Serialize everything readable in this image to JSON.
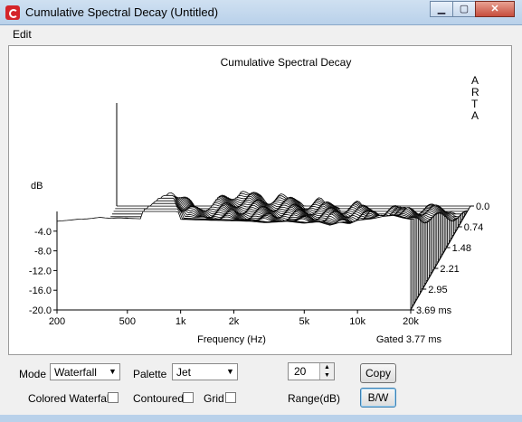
{
  "window": {
    "title": "Cumulative Spectral Decay  (Untitled)",
    "minimize_icon": "minimize-icon",
    "maximize_icon": "maximize-icon",
    "close_icon": "close-icon"
  },
  "menu": {
    "edit": "Edit"
  },
  "chart_data": {
    "type": "waterfall",
    "title": "Cumulative Spectral Decay",
    "watermark": "ARTA",
    "y_axis_title": "dB",
    "y_ticks": [
      "-4.0",
      "-8.0",
      "-12.0",
      "-16.0",
      "-20.0"
    ],
    "ylim": [
      -20,
      0
    ],
    "x_ticks": [
      "200",
      "500",
      "1k",
      "2k",
      "5k",
      "10k",
      "20k"
    ],
    "xlabel": "Frequency (Hz)",
    "xscale": "log",
    "xlim": [
      200,
      20000
    ],
    "time_ticks": [
      "0.0",
      "0.74",
      "1.48",
      "2.21",
      "2.95",
      "3.69 ms"
    ],
    "time_range_ms": [
      0,
      3.69
    ],
    "gated_label": "Gated 3.77 ms",
    "slice_count": 40,
    "first_slice_response": [
      {
        "f": 200,
        "db": -2
      },
      {
        "f": 230,
        "db": -1.8
      },
      {
        "f": 260,
        "db": -1.6
      },
      {
        "f": 300,
        "db": -1.5
      },
      {
        "f": 350,
        "db": -1.2
      },
      {
        "f": 400,
        "db": -1.4
      },
      {
        "f": 450,
        "db": -1.3
      },
      {
        "f": 500,
        "db": -1.4
      },
      {
        "f": 600,
        "db": -1.5
      },
      {
        "f": 700,
        "db": -1.6
      },
      {
        "f": 800,
        "db": -1.5
      },
      {
        "f": 1000,
        "db": -1.6
      },
      {
        "f": 1200,
        "db": -1.7
      },
      {
        "f": 1500,
        "db": -1.8
      },
      {
        "f": 2000,
        "db": -1.9
      },
      {
        "f": 2500,
        "db": -2.0
      },
      {
        "f": 3000,
        "db": -2.3
      },
      {
        "f": 4000,
        "db": -2.0
      },
      {
        "f": 5000,
        "db": -2.4
      },
      {
        "f": 6000,
        "db": -2.1
      },
      {
        "f": 7000,
        "db": -2.8
      },
      {
        "f": 8000,
        "db": -2.2
      },
      {
        "f": 9000,
        "db": -2.5
      },
      {
        "f": 10000,
        "db": -1.8
      },
      {
        "f": 12000,
        "db": -1.5
      },
      {
        "f": 14000,
        "db": -1.0
      },
      {
        "f": 16000,
        "db": -0.8
      },
      {
        "f": 18000,
        "db": -1.3
      },
      {
        "f": 20000,
        "db": -1.6
      }
    ],
    "grid": false
  },
  "controls": {
    "mode_label": "Mode",
    "mode_value": "Waterfall",
    "palette_label": "Palette",
    "palette_value": "Jet",
    "range_value": "20",
    "range_label": "Range(dB)",
    "copy_button": "Copy",
    "bw_button": "B/W",
    "colored_waterfall_label": "Colored Waterfall",
    "contoured_label": "Contoured",
    "grid_label": "Grid"
  }
}
